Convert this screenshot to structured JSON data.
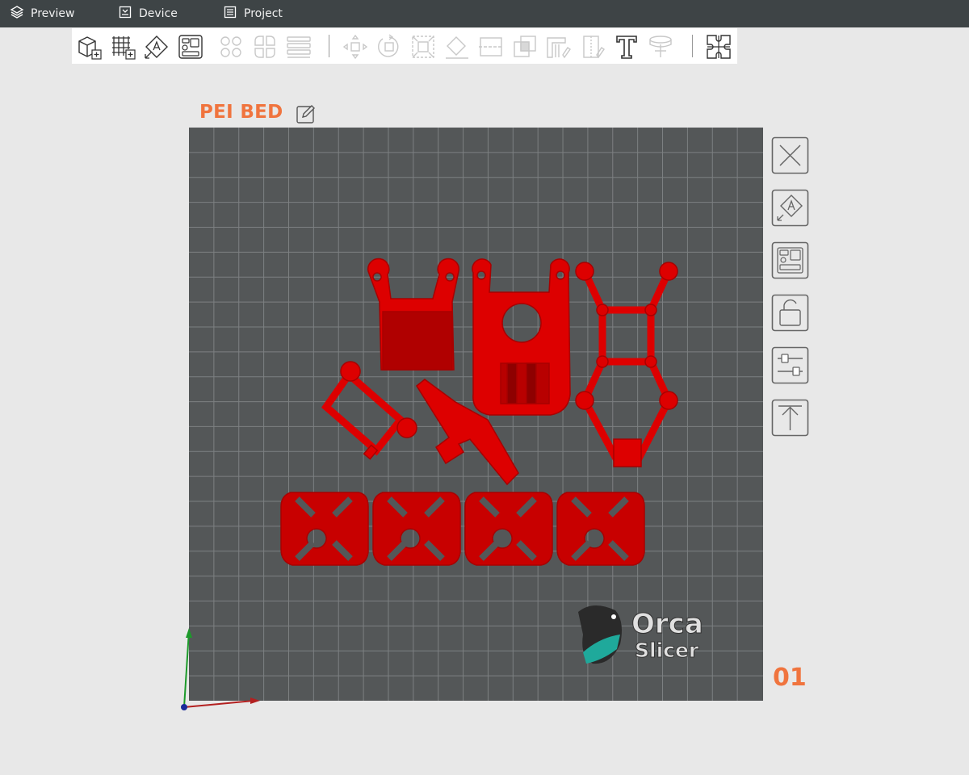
{
  "topbar": {
    "tabs": [
      {
        "label": "Preview",
        "icon": "layers-icon"
      },
      {
        "label": "Device",
        "icon": "device-icon"
      },
      {
        "label": "Project",
        "icon": "project-icon"
      }
    ]
  },
  "toolbar": {
    "tools": [
      "add-object-icon",
      "add-plate-icon",
      "auto-orient-icon",
      "arrange-icon",
      "split-objects-icon",
      "split-parts-icon",
      "layers-settings-icon",
      "move-icon",
      "rotate-icon",
      "scale-icon",
      "lay-on-face-icon",
      "cut-icon",
      "boolean-icon",
      "support-paint-icon",
      "seam-paint-icon",
      "text-icon",
      "measure-icon",
      "assembly-icon"
    ]
  },
  "plate": {
    "name": "PEI BED",
    "number": "01",
    "side_tools": [
      "delete-plate-icon",
      "auto-orient-plate-icon",
      "arrange-plate-icon",
      "lock-plate-icon",
      "plate-settings-icon",
      "move-plate-up-icon"
    ]
  },
  "logo": {
    "line1": "Orca",
    "line2": "Slicer"
  },
  "colors": {
    "accent": "#f0743e",
    "topbar": "#3e4446",
    "bed": "#545758",
    "grid": "#7d8082",
    "model": "#dd0000"
  }
}
